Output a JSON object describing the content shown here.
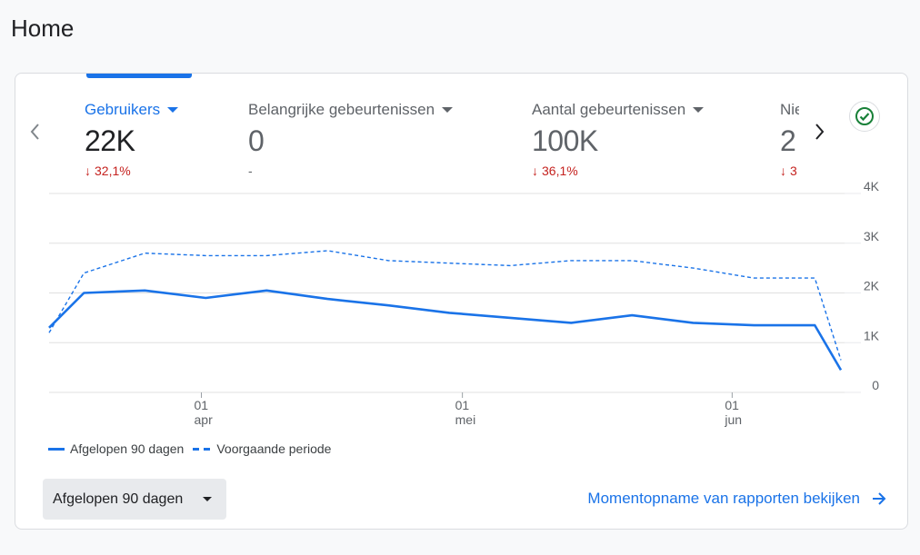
{
  "page": {
    "title": "Home"
  },
  "metrics": [
    {
      "label": "Gebruikers",
      "value": "22K",
      "change": "32,1%",
      "direction": "down",
      "active": true
    },
    {
      "label": "Belangrijke gebeurtenissen",
      "value": "0",
      "change": "-",
      "direction": "none",
      "active": false
    },
    {
      "label": "Aantal gebeurtenissen",
      "value": "100K",
      "change": "36,1%",
      "direction": "down",
      "active": false
    },
    {
      "label": "Nie",
      "value": "2",
      "change": "3",
      "direction": "down",
      "active": false
    }
  ],
  "icons": {
    "prev": "chevron-left-icon",
    "next": "chevron-right-icon",
    "status": "check-circle-icon",
    "link": "arrow-right-icon",
    "down": "arrow-down-icon"
  },
  "colors": {
    "accent": "#1a73e8",
    "negative": "#c5221f",
    "status_ok": "#188038"
  },
  "chart_data": {
    "type": "line",
    "ylim": [
      0,
      4000
    ],
    "y_ticks": [
      {
        "value": 0,
        "label": "0"
      },
      {
        "value": 1000,
        "label": "1K"
      },
      {
        "value": 2000,
        "label": "2K"
      },
      {
        "value": 3000,
        "label": "3K"
      },
      {
        "value": 4000,
        "label": "4K"
      }
    ],
    "x_count": 91,
    "x_ticks": [
      {
        "index": 17.5,
        "day": "01",
        "month": "apr"
      },
      {
        "index": 47.5,
        "day": "01",
        "month": "mei"
      },
      {
        "index": 78.5,
        "day": "01",
        "month": "jun"
      }
    ],
    "series": [
      {
        "name": "Afgelopen 90 dagen",
        "style": "solid",
        "points": [
          [
            0,
            1300
          ],
          [
            4,
            2000
          ],
          [
            11,
            2050
          ],
          [
            18,
            1900
          ],
          [
            25,
            2050
          ],
          [
            32,
            1880
          ],
          [
            39,
            1750
          ],
          [
            46,
            1600
          ],
          [
            53,
            1500
          ],
          [
            60,
            1400
          ],
          [
            67,
            1550
          ],
          [
            74,
            1400
          ],
          [
            81,
            1350
          ],
          [
            88,
            1350
          ],
          [
            91,
            450
          ]
        ]
      },
      {
        "name": "Voorgaande periode",
        "style": "dashed",
        "points": [
          [
            0,
            1200
          ],
          [
            4,
            2400
          ],
          [
            11,
            2800
          ],
          [
            18,
            2750
          ],
          [
            25,
            2750
          ],
          [
            32,
            2850
          ],
          [
            39,
            2650
          ],
          [
            46,
            2600
          ],
          [
            53,
            2550
          ],
          [
            60,
            2650
          ],
          [
            67,
            2650
          ],
          [
            74,
            2500
          ],
          [
            81,
            2300
          ],
          [
            88,
            2300
          ],
          [
            91,
            650
          ]
        ]
      }
    ]
  },
  "legend": {
    "current": "Afgelopen 90 dagen",
    "previous": "Voorgaande periode"
  },
  "controls": {
    "date_range": "Afgelopen 90 dagen",
    "snapshot_link": "Momentopname van rapporten bekijken"
  }
}
